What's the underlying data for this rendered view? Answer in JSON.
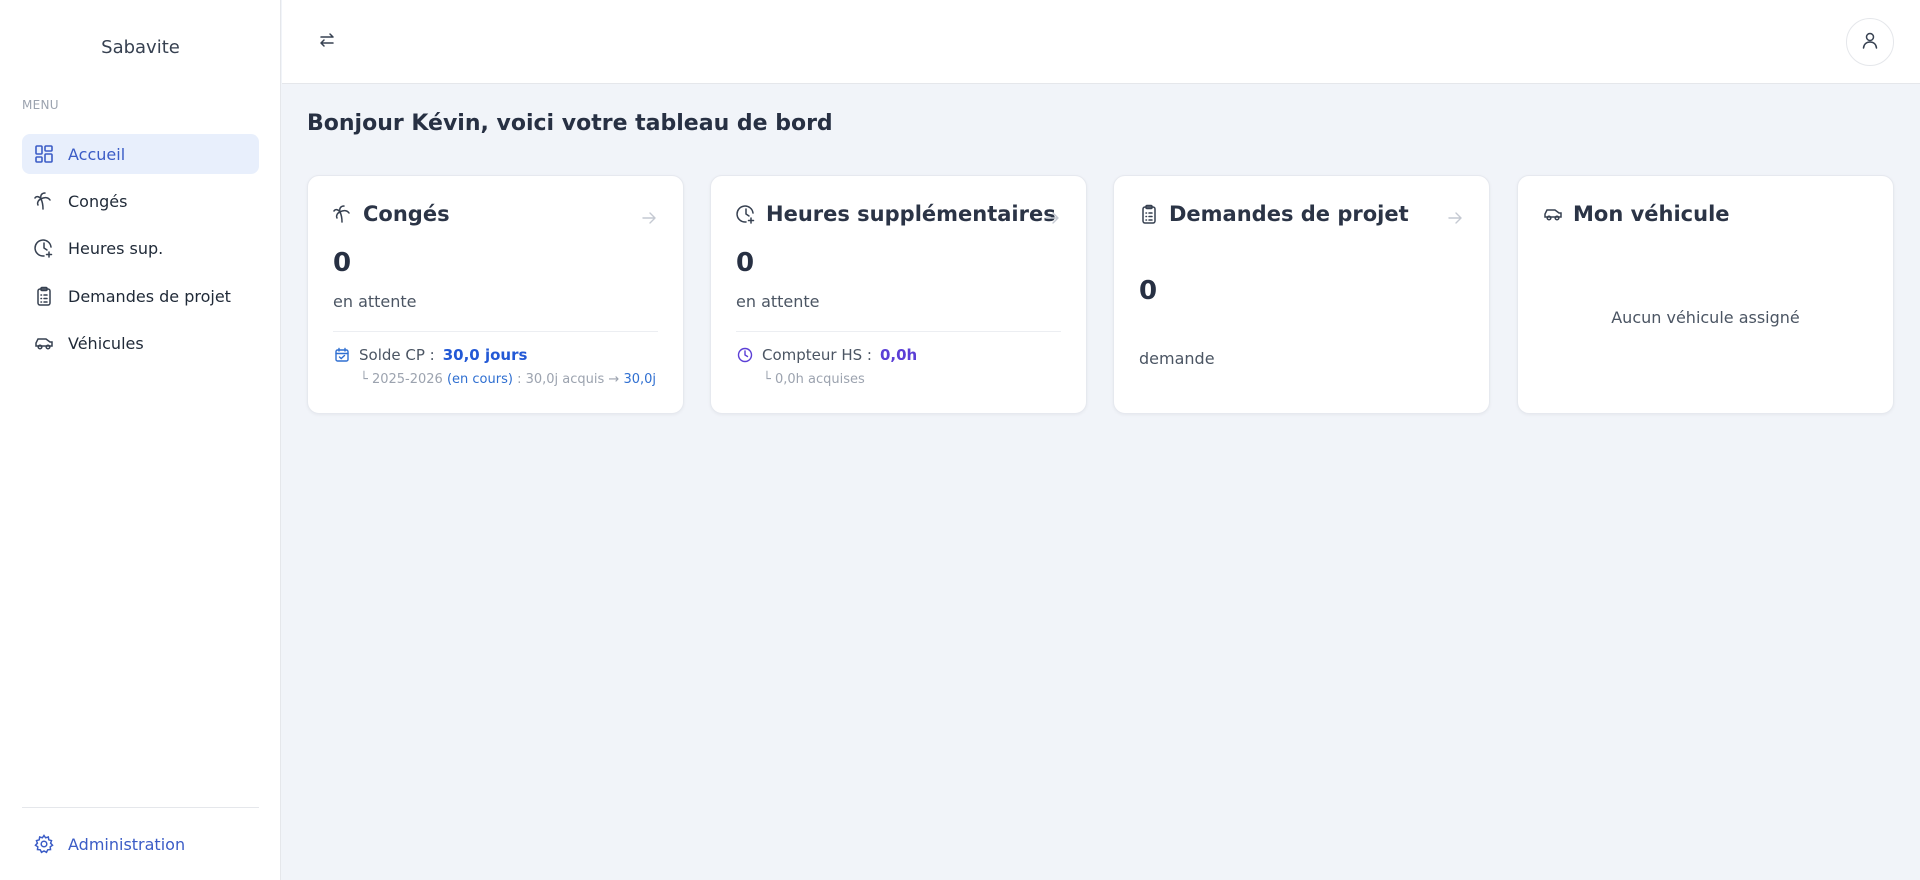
{
  "sidebar": {
    "brand": "Sabavite",
    "menu_label": "MENU",
    "items": [
      {
        "label": "Accueil",
        "icon": "dashboard-icon",
        "active": true
      },
      {
        "label": "Congés",
        "icon": "palm-tree-icon"
      },
      {
        "label": "Heures sup.",
        "icon": "clock-plus-icon"
      },
      {
        "label": "Demandes de projet",
        "icon": "clipboard-list-icon"
      },
      {
        "label": "Véhicules",
        "icon": "car-icon"
      }
    ],
    "admin_label": "Administration"
  },
  "header": {
    "toggle_icon": "arrows-swap-icon",
    "avatar_icon": "user-icon"
  },
  "main": {
    "greeting": "Bonjour Kévin, voici votre tableau de bord",
    "cards": {
      "conges": {
        "title": "Congés",
        "count": "0",
        "count_label": "en attente",
        "balance_label": "Solde CP :",
        "balance_value": "30,0 jours",
        "period_prefix": "└ 2025-2026",
        "period_status": "(en cours)",
        "period_mid": ": 30,0j acquis →",
        "period_value": "30,0j"
      },
      "heures": {
        "title": "Heures supplémentaires",
        "count": "0",
        "count_label": "en attente",
        "counter_label": "Compteur HS :",
        "counter_value": "0,0h",
        "acquired": "└ 0,0h acquises"
      },
      "projets": {
        "title": "Demandes de projet",
        "count": "0",
        "count_label": "demande"
      },
      "vehicule": {
        "title": "Mon véhicule",
        "empty": "Aucun véhicule assigné"
      }
    }
  },
  "colors": {
    "accent": "#3b5cc6",
    "active_bg": "#e8effc",
    "background": "#f1f4f9",
    "highlight_blue": "#2359d6",
    "hs_purple": "#5b3fd6"
  }
}
